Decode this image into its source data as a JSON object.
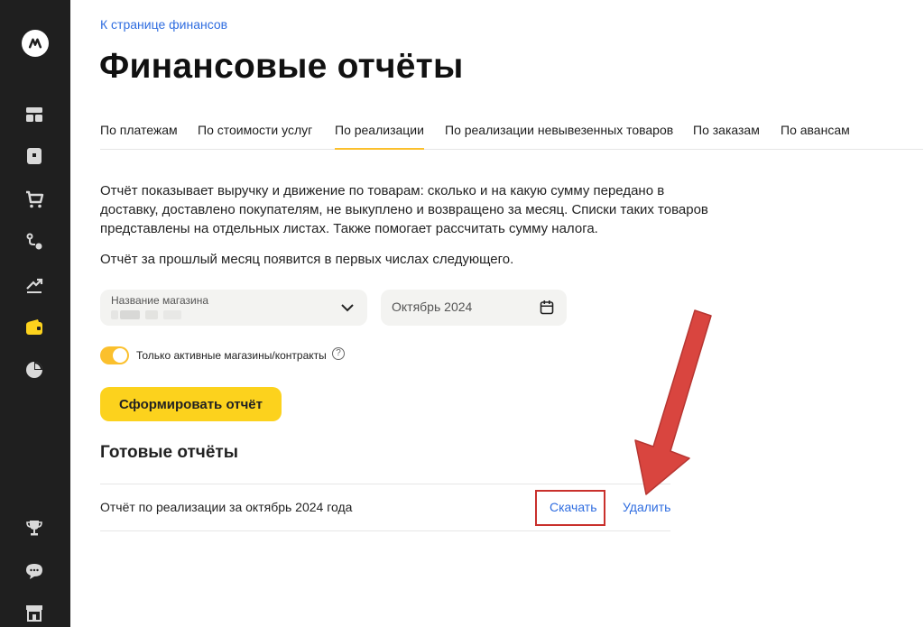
{
  "nav": {
    "back_link": "К странице финансов",
    "title": "Финансовые отчёты"
  },
  "tabs": [
    {
      "label": "По платежам",
      "active": false
    },
    {
      "label": "По стоимости услуг",
      "active": false
    },
    {
      "label": "По реализации",
      "active": true
    },
    {
      "label": "По реализации невывезенных товаров",
      "active": false
    },
    {
      "label": "По заказам",
      "active": false
    },
    {
      "label": "По авансам",
      "active": false
    }
  ],
  "description": {
    "para1": "Отчёт показывает выручку и движение по товарам: сколько и на какую сумму передано в доставку, доставлено покупателям, не выкуплено и возвращено за месяц. Списки таких товаров представлены на отдельных листах. Также помогает рассчитать сумму налога.",
    "para2": "Отчёт за прошлый месяц появится в первых числах следующего."
  },
  "filters": {
    "store_label": "Название магазина",
    "period_value": "Октябрь 2024",
    "toggle_label": "Только активные магазины/контракты",
    "toggle_on": true
  },
  "actions": {
    "generate_label": "Сформировать отчёт"
  },
  "reports": {
    "title": "Готовые отчёты",
    "items": [
      {
        "name": "Отчёт по реализации за октябрь 2024 года",
        "download": "Скачать",
        "delete": "Удалить"
      }
    ]
  },
  "colors": {
    "sidebar_bg": "#1f1f1f",
    "accent_yellow": "#fcd21d",
    "link_blue": "#2f6de0",
    "highlight_red": "#c9302c",
    "annotation_arrow": "#d9453f"
  },
  "sidebar_icons": [
    "market-logo-icon",
    "dashboard-icon",
    "products-icon",
    "cart-icon",
    "logistics-icon",
    "growth-icon",
    "finance-wallet-icon",
    "analytics-pie-icon",
    "trophy-icon",
    "chat-icon",
    "store-icon"
  ]
}
